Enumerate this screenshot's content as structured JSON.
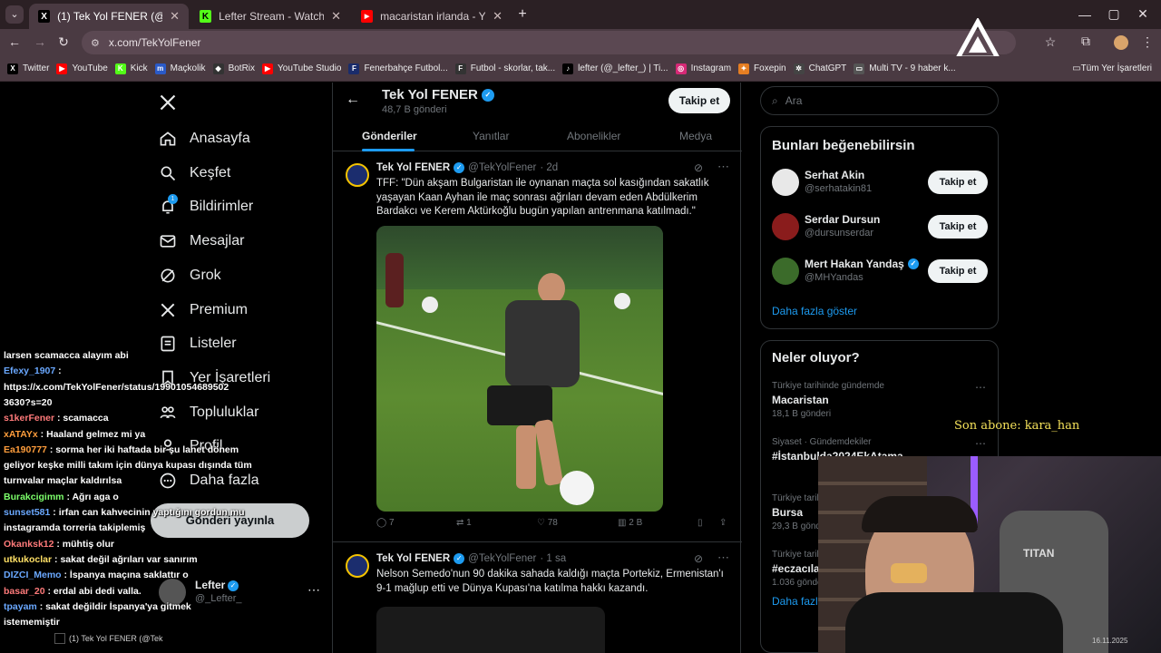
{
  "browser": {
    "tabs": [
      {
        "label": "(1) Tek Yol FENER (@TekYolFenerl",
        "fav": "X",
        "fav_color": "#000000"
      },
      {
        "label": "Lefter Stream - Watch Live on K",
        "fav": "K",
        "fav_color": "#53fc18"
      },
      {
        "label": "macaristan irlanda - YouTube",
        "fav": "▶",
        "fav_color": "#ff0000"
      }
    ],
    "new_tab": "+",
    "url": "x.com/TekYolFener",
    "bookmarks": [
      {
        "label": "Twitter",
        "fav": "X",
        "color": "#000000"
      },
      {
        "label": "YouTube",
        "fav": "▶",
        "color": "#ff0000"
      },
      {
        "label": "Kick",
        "fav": "K",
        "color": "#53fc18"
      },
      {
        "label": "Maçkolik",
        "fav": "m",
        "color": "#2a5ac8"
      },
      {
        "label": "BotRix",
        "fav": "◆",
        "color": "#333333"
      },
      {
        "label": "YouTube Studio",
        "fav": "▶",
        "color": "#ff0000"
      },
      {
        "label": "Fenerbahçe Futbol...",
        "fav": "F",
        "color": "#1a2c6b"
      },
      {
        "label": "Futbol - skorlar, tak...",
        "fav": "F",
        "color": "#333333"
      },
      {
        "label": "lefter (@_lefter_) | Ti...",
        "fav": "♪",
        "color": "#000000"
      },
      {
        "label": "Instagram",
        "fav": "◎",
        "color": "#d62976"
      },
      {
        "label": "Foxepin",
        "fav": "✦",
        "color": "#e67e22"
      },
      {
        "label": "ChatGPT",
        "fav": "✲",
        "color": "#444444"
      },
      {
        "label": "Multi TV - 9 haber k...",
        "fav": "▭",
        "color": "#555555"
      }
    ],
    "all_bookmarks": "Tüm Yer İşaretleri"
  },
  "sidebar": {
    "items": [
      {
        "label": "Anasayfa",
        "icon": "home-icon"
      },
      {
        "label": "Keşfet",
        "icon": "search-icon"
      },
      {
        "label": "Bildirimler",
        "icon": "bell-icon",
        "badge": "1"
      },
      {
        "label": "Mesajlar",
        "icon": "mail-icon"
      },
      {
        "label": "Grok",
        "icon": "grok-icon"
      },
      {
        "label": "Premium",
        "icon": "x-icon"
      },
      {
        "label": "Listeler",
        "icon": "list-icon"
      },
      {
        "label": "Yer İşaretleri",
        "icon": "bookmark-icon"
      },
      {
        "label": "Topluluklar",
        "icon": "people-icon"
      },
      {
        "label": "Profil",
        "icon": "person-icon"
      },
      {
        "label": "Daha fazla",
        "icon": "more-icon"
      }
    ],
    "post_button": "Gönderi yayınla",
    "account": {
      "name": "Lefter",
      "handle": "@_Lefter_"
    }
  },
  "profile": {
    "name": "Tek Yol FENER",
    "posts_count": "48,7 B gönderi",
    "follow": "Takip et",
    "tabs": [
      "Gönderiler",
      "Yanıtlar",
      "Abonelikler",
      "Medya"
    ]
  },
  "posts": [
    {
      "name": "Tek Yol FENER",
      "handle": "@TekYolFener",
      "time": "· 2d",
      "text": "TFF: \"Dün akşam Bulgaristan ile oynanan maçta sol kasığından sakatlık yaşayan Kaan Ayhan ile maç sonrası ağrıları devam eden Abdülkerim Bardakcı ve Kerem Aktürkoğlu bugün yapılan antrenmana katılmadı.\"",
      "replies": "7",
      "reposts": "1",
      "likes": "78",
      "views": "2 B"
    },
    {
      "name": "Tek Yol FENER",
      "handle": "@TekYolFener",
      "time": "· 1 sa",
      "text": "Nelson Semedo'nun 90 dakika sahada kaldığı maçta Portekiz, Ermenistan'ı 9-1 mağlup etti ve Dünya Kupası'na katılma hakkı kazandı."
    }
  ],
  "right": {
    "search_placeholder": "Ara",
    "suggest_title": "Bunları beğenebilirsin",
    "suggestions": [
      {
        "name": "Serhat Akin",
        "handle": "@serhatakin81",
        "verified": false
      },
      {
        "name": "Serdar Dursun",
        "handle": "@dursunserdar",
        "verified": false
      },
      {
        "name": "Mert Hakan Yandaş",
        "handle": "@MHYandas",
        "verified": true
      }
    ],
    "follow": "Takip et",
    "show_more": "Daha fazla göster",
    "trends_title": "Neler oluyor?",
    "trends": [
      {
        "context": "Türkiye tarihinde gündemde",
        "topic": "Macaristan",
        "count": "18,1 B gönderi"
      },
      {
        "context": "Siyaset · Gündemdekiler",
        "topic": "#İstanbulda2024EkAtama",
        "count": ""
      },
      {
        "context": "Türkiye tarihinde",
        "topic": "Bursa",
        "count": "29,3 B gönderi"
      },
      {
        "context": "Türkiye tarihinde",
        "topic": "#eczacıla",
        "count": "1.036 gönderi"
      }
    ],
    "trends_more": "Daha fazla"
  },
  "overlay": {
    "last_sub": "Son abone: kara_han",
    "chat": [
      {
        "user": "",
        "text": "larsen scamacca alayım abi",
        "color": "#ffffff"
      },
      {
        "user": "Efexy_1907",
        "text": ":",
        "color": "#6aa8ff"
      },
      {
        "user": "",
        "text": "https://x.com/TekYolFener/status/19901054689502",
        "color": "#ffffff"
      },
      {
        "user": "",
        "text": "3630?s=20",
        "color": "#ffffff"
      },
      {
        "user": "s1kerFener",
        "text": ": scamacca",
        "color": "#ff7a7a"
      },
      {
        "user": "xATAYx",
        "text": ": Haaland gelmez mi ya",
        "color": "#ff9d3c"
      },
      {
        "user": "Ea190777",
        "text": ": sorma her iki haftada bir şu lanet dönem",
        "color": "#ff9d3c"
      },
      {
        "user": "",
        "text": "geliyor keşke milli takım için dünya kupası dışında tüm",
        "color": "#ffffff"
      },
      {
        "user": "",
        "text": "turnvalar maçlar kaldırılsa",
        "color": "#ffffff"
      },
      {
        "user": "Burakcigimm",
        "text": ": Ağrı aga o",
        "color": "#7cff6b"
      },
      {
        "user": "sunset581",
        "text": ": irfan can kahvecinin yaptığını gordun mu",
        "color": "#6aa8ff"
      },
      {
        "user": "",
        "text": "instagramda torreria takiplemiş",
        "color": "#ffffff"
      },
      {
        "user": "Okanksk12",
        "text": ": mühtiş olur",
        "color": "#ff7a7a"
      },
      {
        "user": "utkukoclar",
        "text": ": sakat değil ağrıları var sanırım",
        "color": "#ffe066"
      },
      {
        "user": "DIZCI_Memo",
        "text": ": İspanya maçına saklattır o",
        "color": "#6aa8ff"
      },
      {
        "user": "basar_20",
        "text": ": erdal abi dedi valla.",
        "color": "#ff7a7a"
      },
      {
        "user": "tpayam",
        "text": ": sakat değildir İspanya'ya gitmek",
        "color": "#6aa8ff"
      },
      {
        "user": "",
        "text": "istememiştir",
        "color": "#ffffff"
      }
    ],
    "taskbar_item": "(1) Tek Yol FENER (@Tek",
    "date": "16.11.2025"
  },
  "colors": {
    "accent": "#1d9bf0",
    "x_bg": "#000000"
  }
}
